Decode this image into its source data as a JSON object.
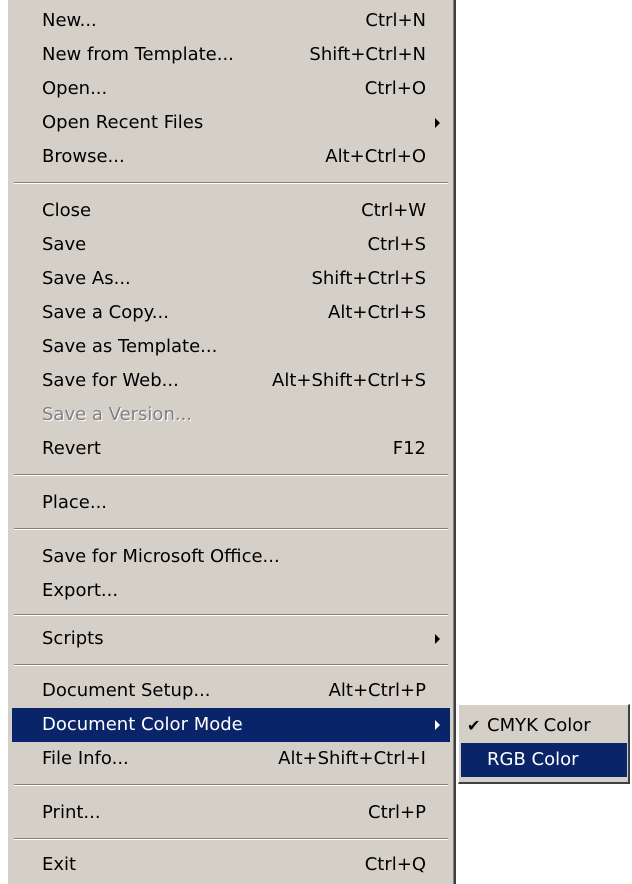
{
  "file_menu": {
    "items": [
      {
        "label": "New...",
        "shortcut": "Ctrl+N"
      },
      {
        "label": "New from Template...",
        "shortcut": "Shift+Ctrl+N"
      },
      {
        "label": "Open...",
        "shortcut": "Ctrl+O"
      },
      {
        "label": "Open Recent Files",
        "shortcut": ""
      },
      {
        "label": "Browse...",
        "shortcut": "Alt+Ctrl+O"
      },
      {
        "label": "Close",
        "shortcut": "Ctrl+W"
      },
      {
        "label": "Save",
        "shortcut": "Ctrl+S"
      },
      {
        "label": "Save As...",
        "shortcut": "Shift+Ctrl+S"
      },
      {
        "label": "Save a Copy...",
        "shortcut": "Alt+Ctrl+S"
      },
      {
        "label": "Save as Template...",
        "shortcut": ""
      },
      {
        "label": "Save for Web...",
        "shortcut": "Alt+Shift+Ctrl+S"
      },
      {
        "label": "Save a Version...",
        "shortcut": ""
      },
      {
        "label": "Revert",
        "shortcut": "F12"
      },
      {
        "label": "Place...",
        "shortcut": ""
      },
      {
        "label": "Save for Microsoft Office...",
        "shortcut": ""
      },
      {
        "label": "Export...",
        "shortcut": ""
      },
      {
        "label": "Scripts",
        "shortcut": ""
      },
      {
        "label": "Document Setup...",
        "shortcut": "Alt+Ctrl+P"
      },
      {
        "label": "Document Color Mode",
        "shortcut": ""
      },
      {
        "label": "File Info...",
        "shortcut": "Alt+Shift+Ctrl+I"
      },
      {
        "label": "Print...",
        "shortcut": "Ctrl+P"
      },
      {
        "label": "Exit",
        "shortcut": "Ctrl+Q"
      }
    ]
  },
  "color_mode_submenu": {
    "items": [
      {
        "label": "CMYK Color",
        "checked": true
      },
      {
        "label": "RGB Color",
        "checked": false
      }
    ],
    "check_glyph": "✔"
  },
  "colors": {
    "menu_background": "#d4d0c8",
    "highlight": "#0a246a",
    "disabled_text": "#808080"
  }
}
